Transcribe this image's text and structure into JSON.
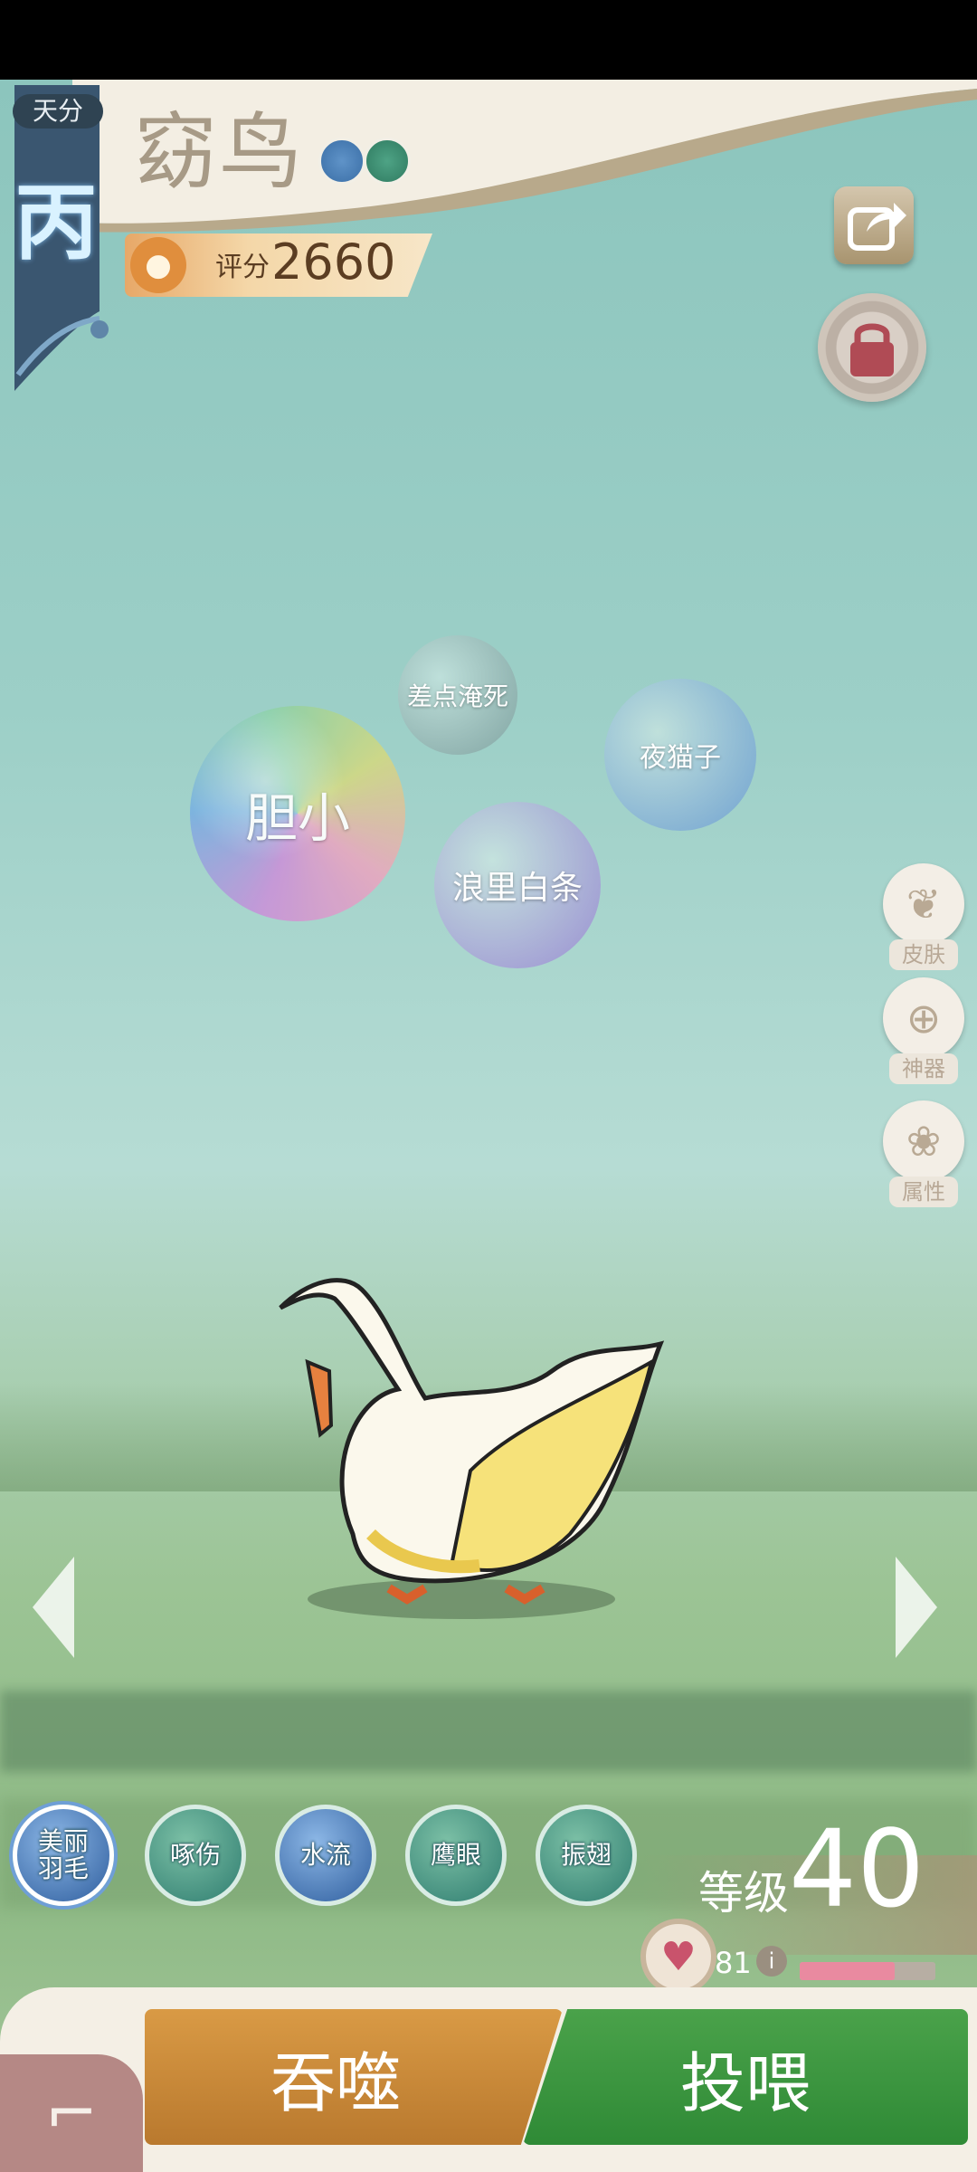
{
  "header": {
    "tianfen_label": "天分",
    "grade": "丙",
    "pet_name": "窈鸟",
    "score_label": "评分",
    "score_value": "2660"
  },
  "icons": {
    "share": "share-icon",
    "lock": "lock-icon",
    "score": "paw-icon"
  },
  "traits": [
    {
      "label": "差点淹死"
    },
    {
      "label": "夜猫子"
    },
    {
      "label": "胆小"
    },
    {
      "label": "浪里白条"
    }
  ],
  "side_menu": [
    {
      "label": "皮肤",
      "icon": "butterfly-icon"
    },
    {
      "label": "神器",
      "icon": "plus-icon"
    },
    {
      "label": "属性",
      "icon": "paw-icon"
    }
  ],
  "skills": [
    {
      "label": "美丽羽毛",
      "line1": "美丽",
      "line2": "羽毛",
      "style": "blue",
      "selected": true
    },
    {
      "label": "啄伤",
      "style": "green"
    },
    {
      "label": "水流",
      "style": "blue"
    },
    {
      "label": "鹰眼",
      "style": "green"
    },
    {
      "label": "振翅",
      "style": "green"
    }
  ],
  "level": {
    "label": "等级",
    "value": "40"
  },
  "affinity": {
    "value": "81",
    "fill_fraction": 0.7
  },
  "actions": {
    "devour": "吞噬",
    "feed": "投喂"
  },
  "colors": {
    "sky": "#8cc5bd",
    "feed_button": "#3c963f",
    "devour_button": "#c8883a",
    "grade_banner": "#3a5670"
  }
}
